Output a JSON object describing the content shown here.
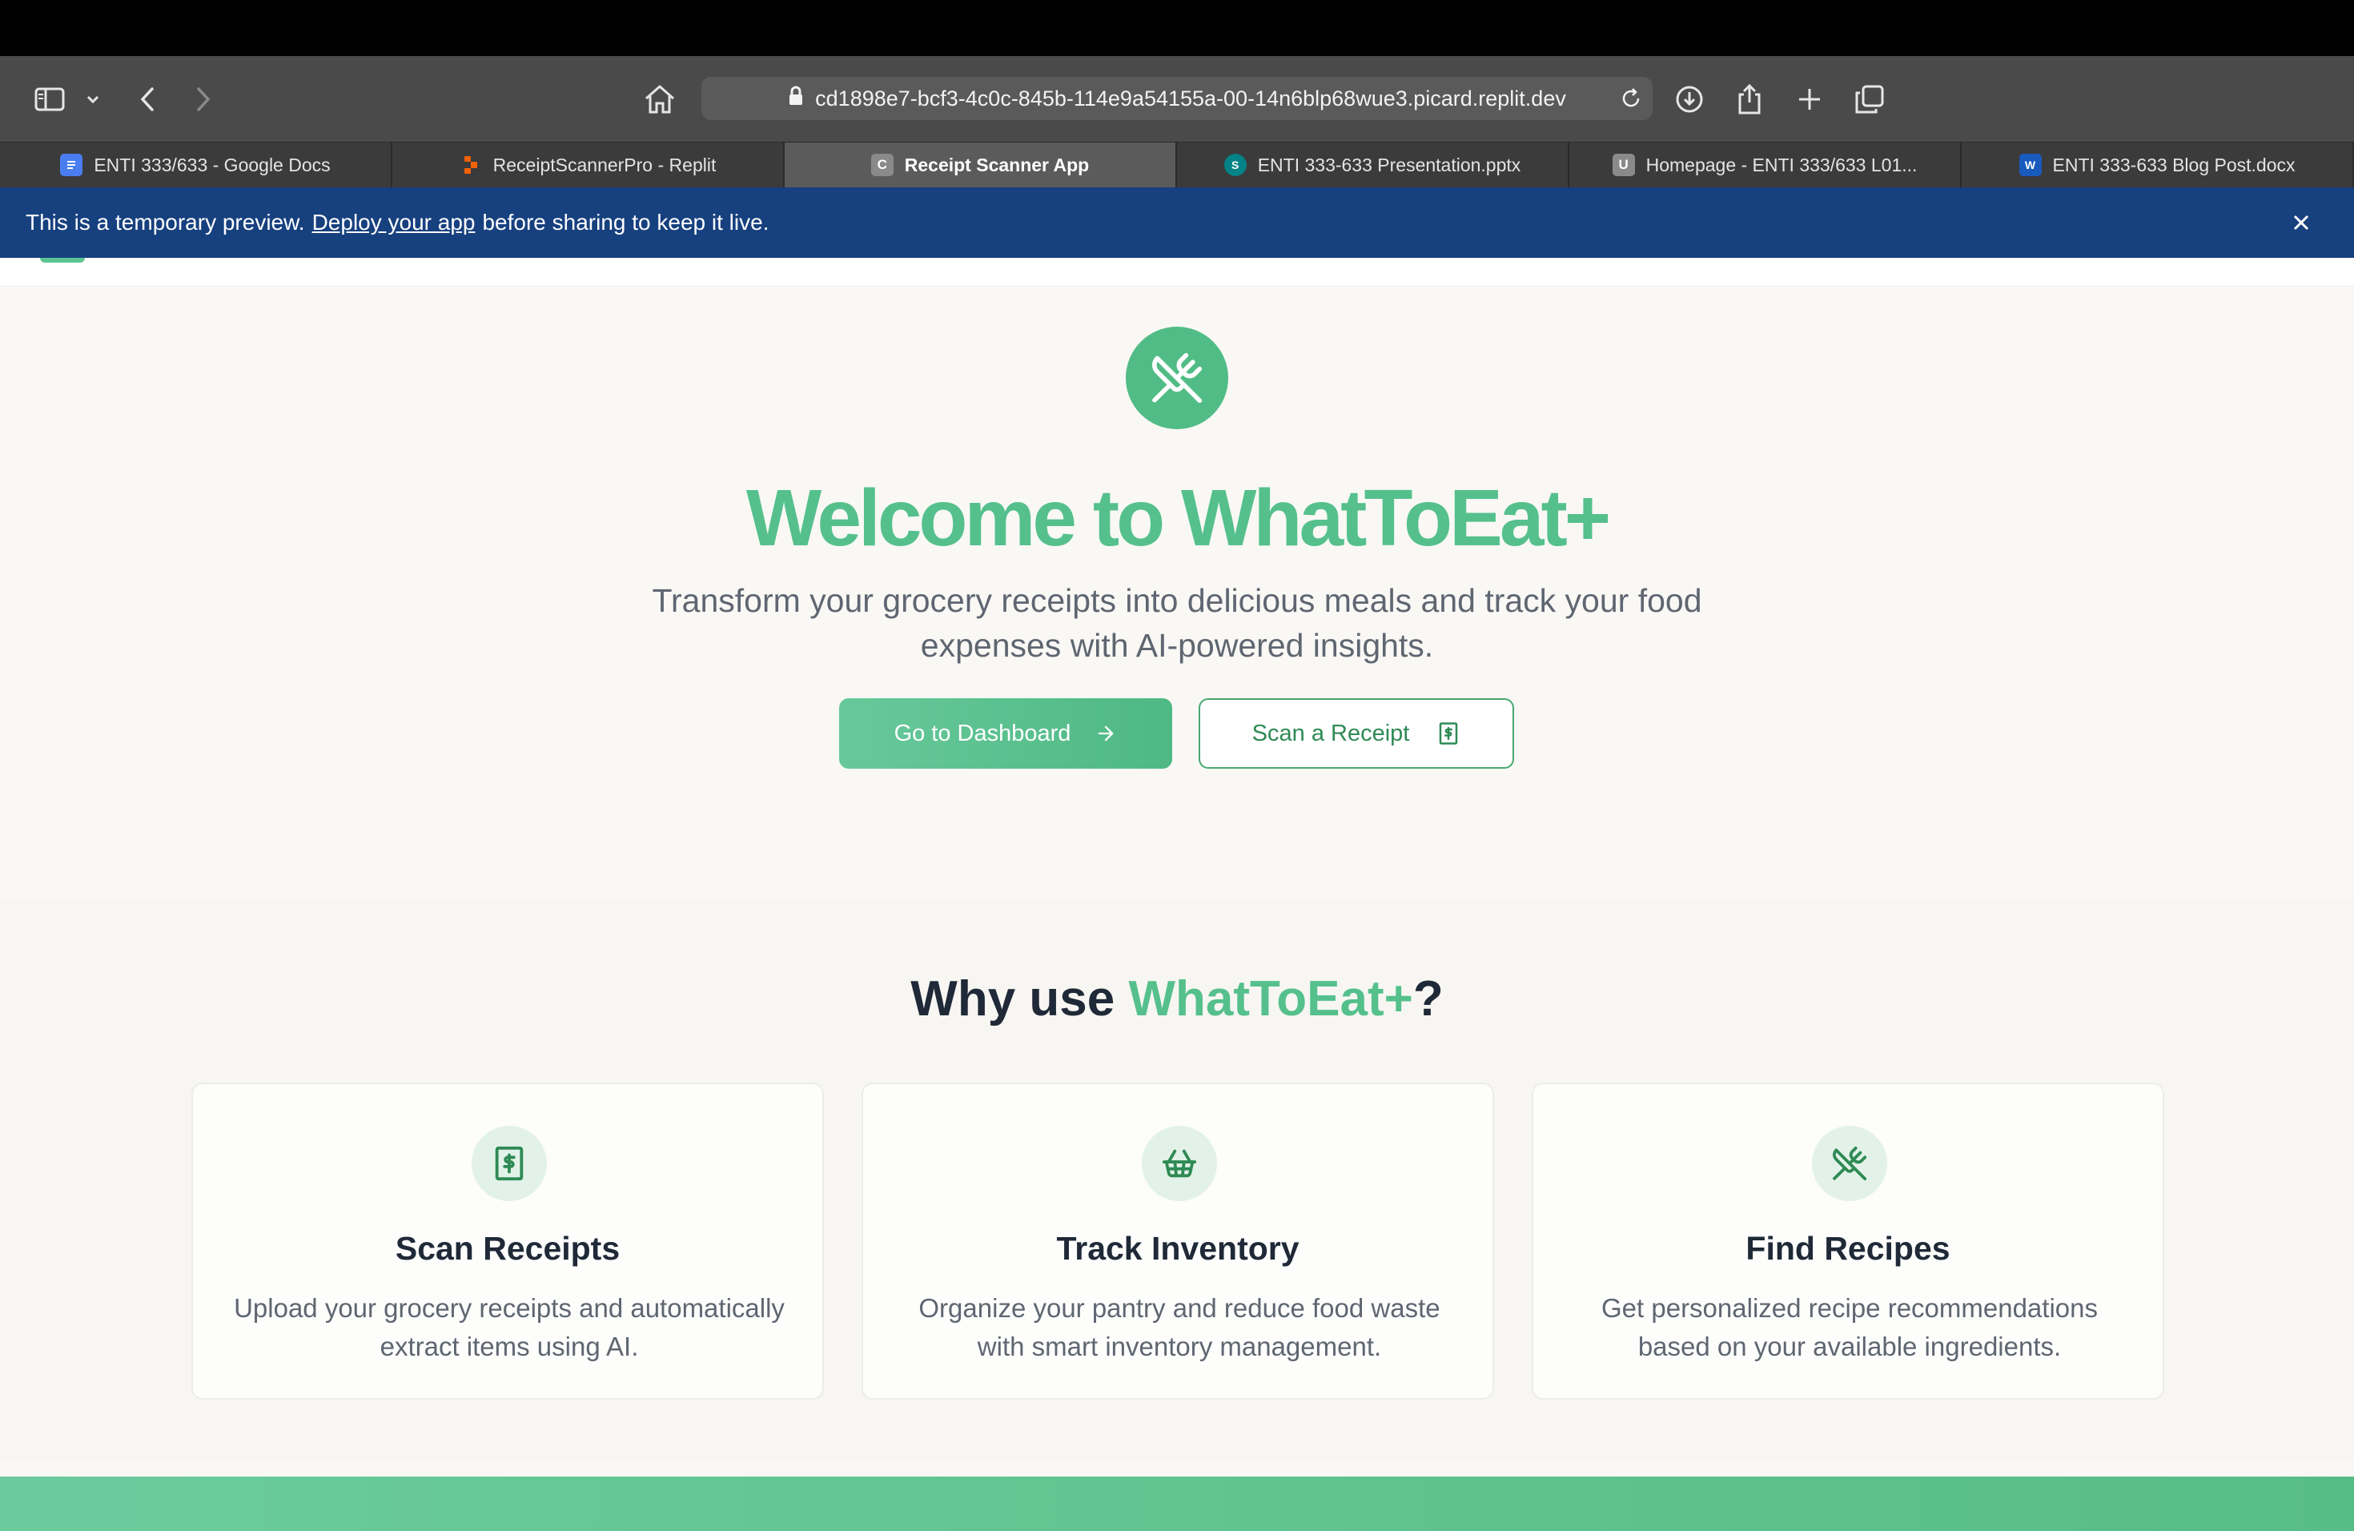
{
  "browser": {
    "url": "cd1898e7-bcf3-4c0c-845b-114e9a54155a-00-14n6blp68wue3.picard.replit.dev",
    "icons": [
      "sidebar-icon",
      "chevron-down-icon",
      "back-icon",
      "forward-icon",
      "home-icon",
      "lock-icon",
      "reload-icon",
      "download-icon",
      "share-icon",
      "new-tab-icon",
      "tab-overview-icon"
    ],
    "tabs": [
      {
        "label": "ENTI 333/633 - Google Docs",
        "icon": "google-docs-icon",
        "icon_color": "#4a7ef0",
        "active": false
      },
      {
        "label": "ReceiptScannerPro - Replit",
        "icon": "replit-icon",
        "icon_color": "#f26207",
        "active": false
      },
      {
        "label": "Receipt Scanner App",
        "icon": "C",
        "icon_color": "#8a8a8a",
        "active": true
      },
      {
        "label": "ENTI 333-633 Presentation.pptx",
        "icon": "sharepoint-icon",
        "icon_color": "#038387",
        "active": false
      },
      {
        "label": "Homepage - ENTI 333/633 L01...",
        "icon": "U",
        "icon_color": "#8a8a8a",
        "active": false
      },
      {
        "label": "ENTI 333-633 Blog Post.docx",
        "icon": "word-icon",
        "icon_color": "#185abd",
        "active": false
      }
    ]
  },
  "banner": {
    "before": "This is a temporary preview.",
    "link": "Deploy your app",
    "after": "before sharing to keep it live."
  },
  "hero": {
    "icon": "utensils-crossed-icon",
    "title": "Welcome to WhatToEat+",
    "subtitle": "Transform your grocery receipts into delicious meals and track your food expenses with AI-powered insights.",
    "primary_button": "Go to Dashboard",
    "secondary_button": "Scan a Receipt"
  },
  "why": {
    "title_prefix": "Why use ",
    "title_brand": "WhatToEat+",
    "title_suffix": "?"
  },
  "features": [
    {
      "icon": "receipt-icon",
      "title": "Scan Receipts",
      "desc": "Upload your grocery receipts and automatically extract items using AI."
    },
    {
      "icon": "shopping-basket-icon",
      "title": "Track Inventory",
      "desc": "Organize your pantry and reduce food waste with smart inventory management."
    },
    {
      "icon": "utensils-crossed-icon",
      "title": "Find Recipes",
      "desc": "Get personalized recipe recommendations based on your available ingredients."
    }
  ],
  "colors": {
    "brand_green": "#55c08c",
    "banner_blue": "#17407f",
    "button_green": "#4fb884"
  }
}
